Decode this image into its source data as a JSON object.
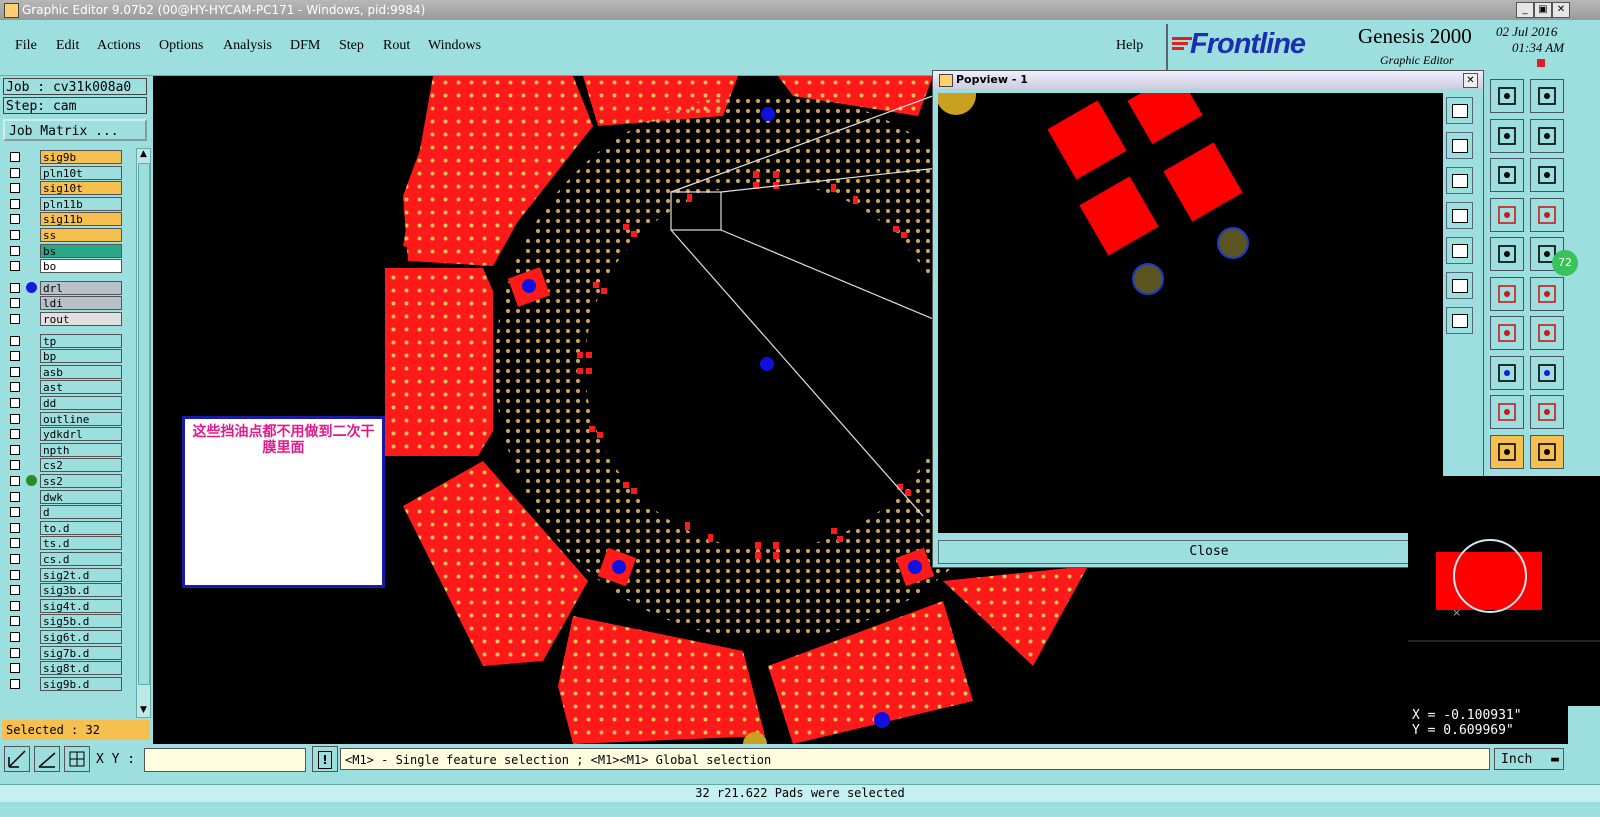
{
  "window": {
    "title": "Graphic Editor 9.07b2 (00@HY-HYCAM-PC171 - Windows, pid:9984)"
  },
  "menu": [
    "File",
    "Edit",
    "Actions",
    "Options",
    "Analysis",
    "DFM",
    "Step",
    "Rout",
    "Windows"
  ],
  "help": "Help",
  "brand": {
    "logo": "Frontline",
    "product": "Genesis 2000",
    "subtitle": "Graphic Editor",
    "date": "02  Jul  2016",
    "time": "01:34  AM"
  },
  "job": "Job : cv31k008a0",
  "step": "Step: cam",
  "job_matrix": "Job Matrix ...",
  "layers": [
    {
      "name": "sig9b",
      "color": "#f5c050"
    },
    {
      "name": "pln10t",
      "color": "#9ddede"
    },
    {
      "name": "sig10t",
      "color": "#f5c050"
    },
    {
      "name": "pln11b",
      "color": "#9ddede"
    },
    {
      "name": "sig11b",
      "color": "#f5c050"
    },
    {
      "name": "ss",
      "color": "#f5c050"
    },
    {
      "name": "bs",
      "color": "#2aa888"
    },
    {
      "name": "bo",
      "color": "#ffffff"
    },
    {
      "name": "drl",
      "color": "#b8c0c8",
      "dot": "#1818e0"
    },
    {
      "name": "ldi",
      "color": "#b8c0c8"
    },
    {
      "name": "rout",
      "color": "#e0e0e0"
    },
    {
      "name": "tp",
      "color": "#9ddede"
    },
    {
      "name": "bp",
      "color": "#9ddede"
    },
    {
      "name": "asb",
      "color": "#9ddede"
    },
    {
      "name": "ast",
      "color": "#9ddede"
    },
    {
      "name": "dd",
      "color": "#9ddede"
    },
    {
      "name": "outline",
      "color": "#9ddede"
    },
    {
      "name": "ydkdrl",
      "color": "#9ddede"
    },
    {
      "name": "npth",
      "color": "#9ddede"
    },
    {
      "name": "cs2",
      "color": "#9ddede"
    },
    {
      "name": "ss2",
      "color": "#9ddede",
      "dot": "#2a8a2a"
    },
    {
      "name": "dwk",
      "color": "#9ddede"
    },
    {
      "name": "d",
      "color": "#9ddede"
    },
    {
      "name": "to.d",
      "color": "#9ddede"
    },
    {
      "name": "ts.d",
      "color": "#9ddede"
    },
    {
      "name": "cs.d",
      "color": "#9ddede"
    },
    {
      "name": "sig2t.d",
      "color": "#9ddede"
    },
    {
      "name": "sig3b.d",
      "color": "#9ddede"
    },
    {
      "name": "sig4t.d",
      "color": "#9ddede"
    },
    {
      "name": "sig5b.d",
      "color": "#9ddede"
    },
    {
      "name": "sig6t.d",
      "color": "#9ddede"
    },
    {
      "name": "sig7b.d",
      "color": "#9ddede"
    },
    {
      "name": "sig8t.d",
      "color": "#9ddede"
    },
    {
      "name": "sig9b.d",
      "color": "#9ddede"
    }
  ],
  "selected": "Selected : 32",
  "annotation": "这些挡油点都不用做到二次干膜里面",
  "popview": {
    "title": "Popview - 1",
    "close": "Close"
  },
  "xy_label": "X Y :",
  "xy_value": "",
  "message": "<M1> - Single feature selection ; <M1><M1> Global selection",
  "units": "Inch",
  "coords": {
    "x": "X = -0.100931\"",
    "y": "Y = 0.609969\""
  },
  "status": "32 r21.622 Pads were selected",
  "badge": "72",
  "colors": {
    "pad_red": "#ff0000",
    "pad_gold": "#c8a040",
    "hole_blue": "#1010e0",
    "bg": "#9ddede"
  }
}
